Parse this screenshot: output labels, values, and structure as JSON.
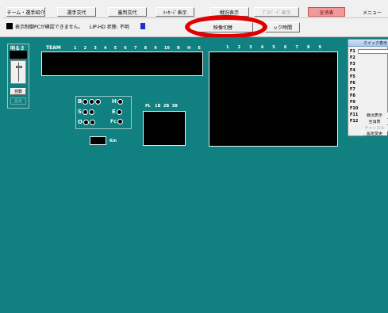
{
  "toolbar": {
    "buttons": [
      "チーム・選手紹介",
      "選手交代",
      "審判交代",
      "ﾒｯｾｰｼﾞ表示",
      "戦況表示",
      "ﾌﾟﾛﾊﾟｰﾄﾞ表示",
      "全消表",
      "メニュー"
    ],
    "status_text": "表示制御PCが確認できません。",
    "lip_status": "LIP-HD 状態: 不明",
    "switch_button": "映像切替",
    "time_button": "ック時間"
  },
  "colors": {
    "field": "#118080",
    "status_indicator": "#1a2fd6",
    "annotation": "#e00000"
  },
  "brightness": {
    "label": "明るさ",
    "auto_button": "自動",
    "set_button": "設定"
  },
  "scoreboard": {
    "team_label": "TEAM",
    "innings": [
      "1",
      "2",
      "3",
      "4",
      "5",
      "6",
      "7",
      "8",
      "9",
      "10",
      "R",
      "H",
      "E"
    ],
    "right_innings": [
      "1",
      "2",
      "3",
      "4",
      "5",
      "6",
      "7",
      "8",
      "9"
    ]
  },
  "count": {
    "b_label": "B",
    "h_label": "H",
    "s_label": "S",
    "e_label": "E",
    "o_label": "O",
    "fc_label": "Fc",
    "kmh_label": "Km"
  },
  "pitch": {
    "pl_label": "PL",
    "cols": [
      "1B",
      "2B",
      "3B"
    ]
  },
  "quick": {
    "title": "クイック表示",
    "keys": [
      "F1",
      "F2",
      "F3",
      "F4",
      "F5",
      "F6",
      "F7",
      "F8",
      "F9",
      "F10",
      "F11",
      "F12"
    ],
    "f11_button": "戦況表示",
    "f12_button": "全消表",
    "check_button": "チャンカル",
    "settings_button": "設定変更"
  }
}
